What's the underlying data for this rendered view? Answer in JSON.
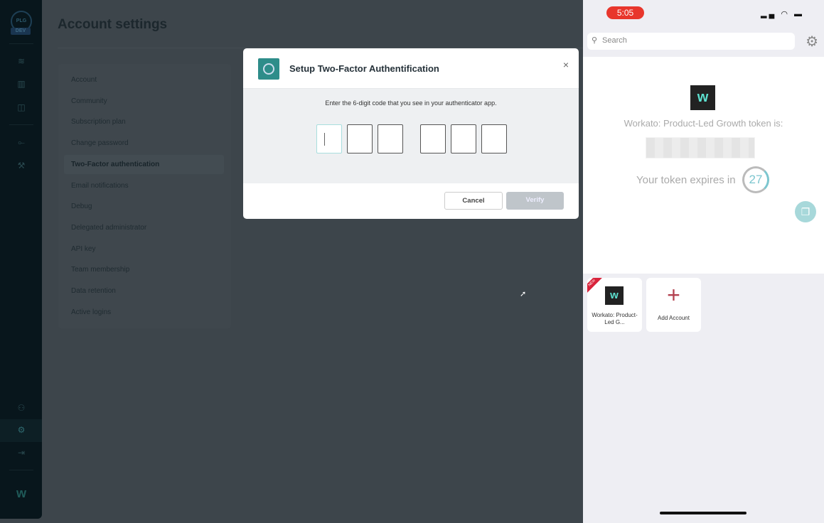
{
  "app": {
    "title": "Account settings",
    "logo_text": "PLG",
    "env_badge": "DEV",
    "sidebar_icons": [
      "database-icon",
      "chart-icon",
      "book-icon",
      "connections-icon",
      "wrench-icon",
      "team-icon",
      "gear-icon",
      "logout-icon",
      "workato-logo-icon"
    ],
    "menu": [
      "Account",
      "Community",
      "Subscription plan",
      "Change password",
      "Two-Factor authentication",
      "Email notifications",
      "Debug",
      "Delegated administrator",
      "API key",
      "Team membership",
      "Data retention",
      "Active logins"
    ],
    "active_menu": "Two-Factor authentication"
  },
  "modal": {
    "title": "Setup Two-Factor Authentification",
    "close": "×",
    "instruction": "Enter the 6-digit code that you see in your authenticator app.",
    "digits": [
      "",
      "",
      "",
      "",
      "",
      ""
    ],
    "cancel": "Cancel",
    "verify": "Verify"
  },
  "phone": {
    "time": "5:05",
    "search_placeholder": "Search",
    "token_label": "Workato: Product-Led Growth token is:",
    "expires_label": "Your token expires in",
    "expires_seconds": "27",
    "accounts": [
      {
        "label": "Workato: Product-Led G...",
        "badge": "NEW"
      },
      {
        "label": "Add Account"
      }
    ],
    "accent": "#7cc6cf"
  }
}
